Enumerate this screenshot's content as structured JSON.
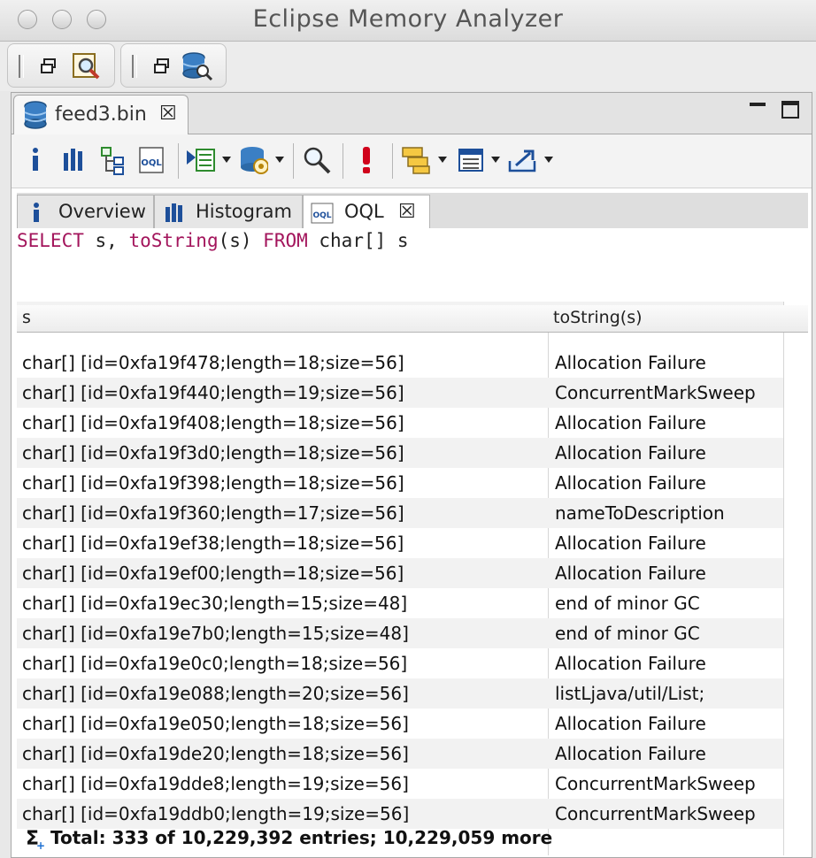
{
  "window": {
    "title": "Eclipse Memory Analyzer"
  },
  "editor": {
    "tab_label": "feed3.bin"
  },
  "inner_tabs": [
    {
      "label": "Overview"
    },
    {
      "label": "Histogram"
    },
    {
      "label": "OQL"
    }
  ],
  "query": {
    "tokens": [
      {
        "text": "SELECT",
        "kind": "kw"
      },
      {
        "text": " s, ",
        "kind": "plain"
      },
      {
        "text": "toString",
        "kind": "kw"
      },
      {
        "text": "(s) ",
        "kind": "plain"
      },
      {
        "text": "FROM",
        "kind": "kw"
      },
      {
        "text": " char[] s",
        "kind": "plain"
      }
    ]
  },
  "table": {
    "columns": [
      "s",
      "toString(s)"
    ],
    "rows": [
      {
        "s": "char[] [id=0xfa19f478;length=18;size=56]",
        "str": "Allocation Failure"
      },
      {
        "s": "char[] [id=0xfa19f440;length=19;size=56]",
        "str": "ConcurrentMarkSweep"
      },
      {
        "s": "char[] [id=0xfa19f408;length=18;size=56]",
        "str": "Allocation Failure"
      },
      {
        "s": "char[] [id=0xfa19f3d0;length=18;size=56]",
        "str": "Allocation Failure"
      },
      {
        "s": "char[] [id=0xfa19f398;length=18;size=56]",
        "str": "Allocation Failure"
      },
      {
        "s": "char[] [id=0xfa19f360;length=17;size=56]",
        "str": "nameToDescription"
      },
      {
        "s": "char[] [id=0xfa19ef38;length=18;size=56]",
        "str": "Allocation Failure"
      },
      {
        "s": "char[] [id=0xfa19ef00;length=18;size=56]",
        "str": "Allocation Failure"
      },
      {
        "s": "char[] [id=0xfa19ec30;length=15;size=48]",
        "str": "end of minor GC"
      },
      {
        "s": "char[] [id=0xfa19e7b0;length=15;size=48]",
        "str": "end of minor GC"
      },
      {
        "s": "char[] [id=0xfa19e0c0;length=18;size=56]",
        "str": "Allocation Failure"
      },
      {
        "s": "char[] [id=0xfa19e088;length=20;size=56]",
        "str": "listLjava/util/List;"
      },
      {
        "s": "char[] [id=0xfa19e050;length=18;size=56]",
        "str": "Allocation Failure"
      },
      {
        "s": "char[] [id=0xfa19de20;length=18;size=56]",
        "str": "Allocation Failure"
      },
      {
        "s": "char[] [id=0xfa19dde8;length=19;size=56]",
        "str": "ConcurrentMarkSweep"
      },
      {
        "s": "char[] [id=0xfa19ddb0;length=19;size=56]",
        "str": "ConcurrentMarkSweep"
      }
    ],
    "total": "Total: 333 of 10,229,392 entries; 10,229,059 more"
  }
}
